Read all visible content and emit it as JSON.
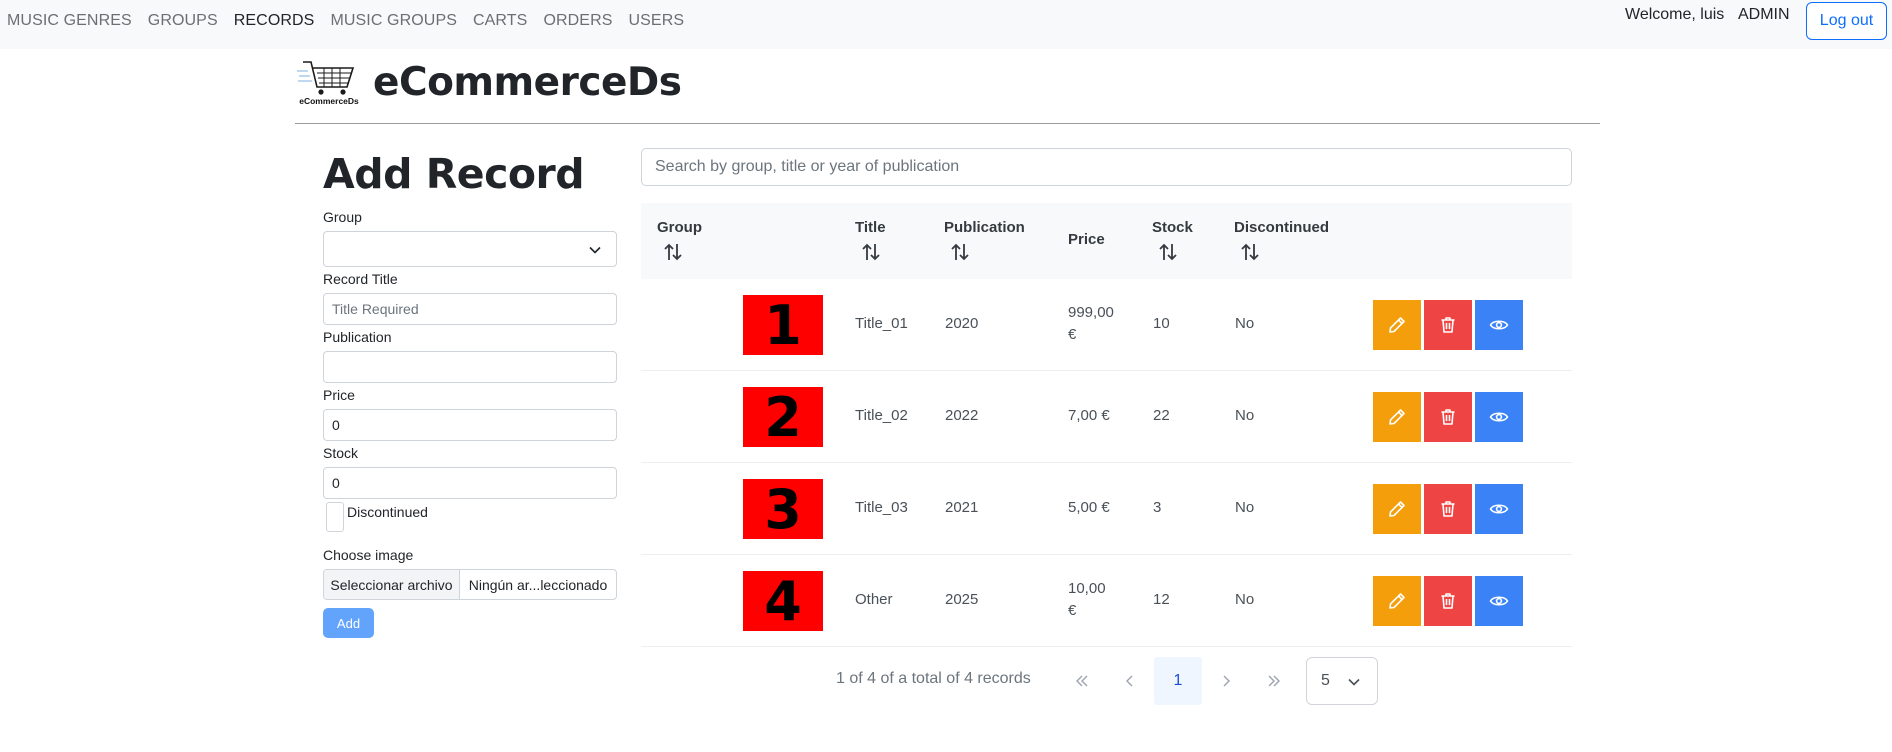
{
  "nav": {
    "items": [
      {
        "label": "MUSIC GENRES",
        "active": false
      },
      {
        "label": "GROUPS",
        "active": false
      },
      {
        "label": "RECORDS",
        "active": true
      },
      {
        "label": "MUSIC GROUPS",
        "active": false
      },
      {
        "label": "CARTS",
        "active": false
      },
      {
        "label": "ORDERS",
        "active": false
      },
      {
        "label": "USERS",
        "active": false
      }
    ],
    "welcome": "Welcome, luis",
    "role": "ADMIN",
    "logout": "Log out"
  },
  "brand": {
    "title": "eCommerceDs",
    "logo_text": "eCommerceDs"
  },
  "form": {
    "title": "Add Record",
    "group_label": "Group",
    "group_value": "",
    "title_label": "Record Title",
    "title_placeholder": "Title Required",
    "publication_label": "Publication",
    "publication_value": "",
    "price_label": "Price",
    "price_value": "0",
    "stock_label": "Stock",
    "stock_value": "0",
    "discontinued_label": "Discontinued",
    "image_label": "Choose image",
    "file_button": "Seleccionar archivo",
    "file_name": "Ningún ar...leccionado",
    "add_button": "Add"
  },
  "search": {
    "placeholder": "Search by group, title or year of publication"
  },
  "table": {
    "headers": [
      "Group",
      "Title",
      "Publication",
      "Price",
      "Stock",
      "Discontinued"
    ],
    "rows": [
      {
        "image": "1",
        "title": "Title_01",
        "publication": "2020",
        "price_1": "999,00",
        "price_2": "€",
        "stock": "10",
        "discontinued": "No"
      },
      {
        "image": "2",
        "title": "Title_02",
        "publication": "2022",
        "price_1": "7,00 €",
        "price_2": "",
        "stock": "22",
        "discontinued": "No"
      },
      {
        "image": "3",
        "title": "Title_03",
        "publication": "2021",
        "price_1": "5,00 €",
        "price_2": "",
        "stock": "3",
        "discontinued": "No"
      },
      {
        "image": "4",
        "title": "Other",
        "publication": "2025",
        "price_1": "10,00",
        "price_2": "€",
        "stock": "12",
        "discontinued": "No"
      }
    ]
  },
  "paginator": {
    "info": "1 of 4 of a total of 4 records",
    "current_page": "1",
    "rows_per_page": "5"
  },
  "colors": {
    "edit": "#f59e0b",
    "delete": "#ef4444",
    "view": "#3b82f6",
    "image_bg": "#ff0000",
    "primary": "#0d6efd"
  }
}
